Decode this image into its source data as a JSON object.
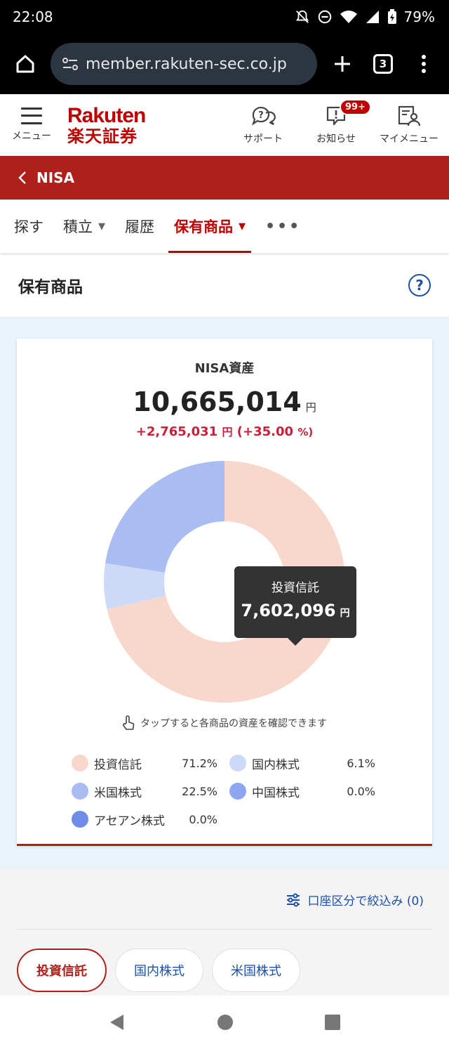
{
  "status": {
    "time": "22:08",
    "battery": "79%"
  },
  "browser": {
    "url": "member.rakuten-sec.co.jp",
    "tab_count": "3"
  },
  "header": {
    "menu_label": "メニュー",
    "logo_top": "Rakuten",
    "logo_bottom": "楽天証券",
    "support_label": "サポート",
    "news_label": "お知らせ",
    "news_badge": "99+",
    "mymenu_label": "マイメニュー"
  },
  "nisa_bar": {
    "label": "NISA"
  },
  "tabs": [
    {
      "label": "探す"
    },
    {
      "label": "積立"
    },
    {
      "label": "履歴"
    },
    {
      "label": "保有商品"
    },
    {
      "label": "•••"
    }
  ],
  "page": {
    "title": "保有商品"
  },
  "summary": {
    "title": "NISA資産",
    "total_value": "10,665,014",
    "yen_unit": "円",
    "gain_value": "+2,765,031",
    "gain_unit": "円",
    "gain_pct": "(+35.00",
    "gain_pct_unit": "%)",
    "tooltip_label": "投資信託",
    "tooltip_value": "7,602,096",
    "tooltip_unit": "円",
    "tap_hint": "タップすると各商品の資産を確認できます"
  },
  "chart_data": {
    "type": "pie",
    "categories": [
      "投資信託",
      "国内株式",
      "米国株式",
      "中国株式",
      "アセアン株式"
    ],
    "values": [
      71.2,
      6.1,
      22.5,
      0.0,
      0.0
    ],
    "colors": [
      "#f8d8cc",
      "#ccdaf7",
      "#aabdf3",
      "#8ea6ef",
      "#6f8de8"
    ]
  },
  "legend": [
    {
      "name": "投資信託",
      "pct": "71.2%"
    },
    {
      "name": "国内株式",
      "pct": "6.1%"
    },
    {
      "name": "米国株式",
      "pct": "22.5%"
    },
    {
      "name": "中国株式",
      "pct": "0.0%"
    },
    {
      "name": "アセアン株式",
      "pct": "0.0%"
    }
  ],
  "filter": {
    "label": "口座区分で絞込み (0)",
    "chips": [
      {
        "label": "投資信託"
      },
      {
        "label": "国内株式"
      },
      {
        "label": "米国株式"
      }
    ]
  }
}
